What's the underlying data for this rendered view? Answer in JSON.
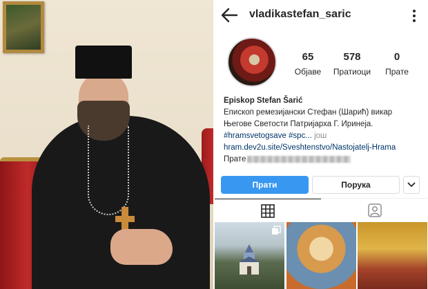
{
  "profile": {
    "username": "vladikastefan_saric",
    "stats": [
      {
        "value": "65",
        "label": "Објаве"
      },
      {
        "value": "578",
        "label": "Пратиоци"
      },
      {
        "value": "0",
        "label": "Прате"
      }
    ],
    "name": "Episkop Stefan Šarić",
    "bio_line1": "Епископ ремезијански Стефан (Шарић) викар",
    "bio_line2": "Његове Светости Патријарха Г. Иринеја.",
    "hashtag1": "#hramsvetogsave",
    "hashtag2": "#spc...",
    "more_label": "још",
    "link": "hram.dev2u.site/Sveshtenstvo/Nastojatelj-Hrama",
    "followed_by_label": "Прате"
  },
  "buttons": {
    "follow": "Прати",
    "message": "Порука"
  },
  "icons": {
    "back": "arrow-left-icon",
    "more": "vertical-dots-icon",
    "dropdown": "chevron-down-icon",
    "grid": "grid-icon",
    "tagged": "tagged-person-icon",
    "multi": "multiple-posts-icon"
  },
  "colors": {
    "accent": "#3897f0",
    "link": "#003569",
    "muted": "#8e8e8e"
  }
}
